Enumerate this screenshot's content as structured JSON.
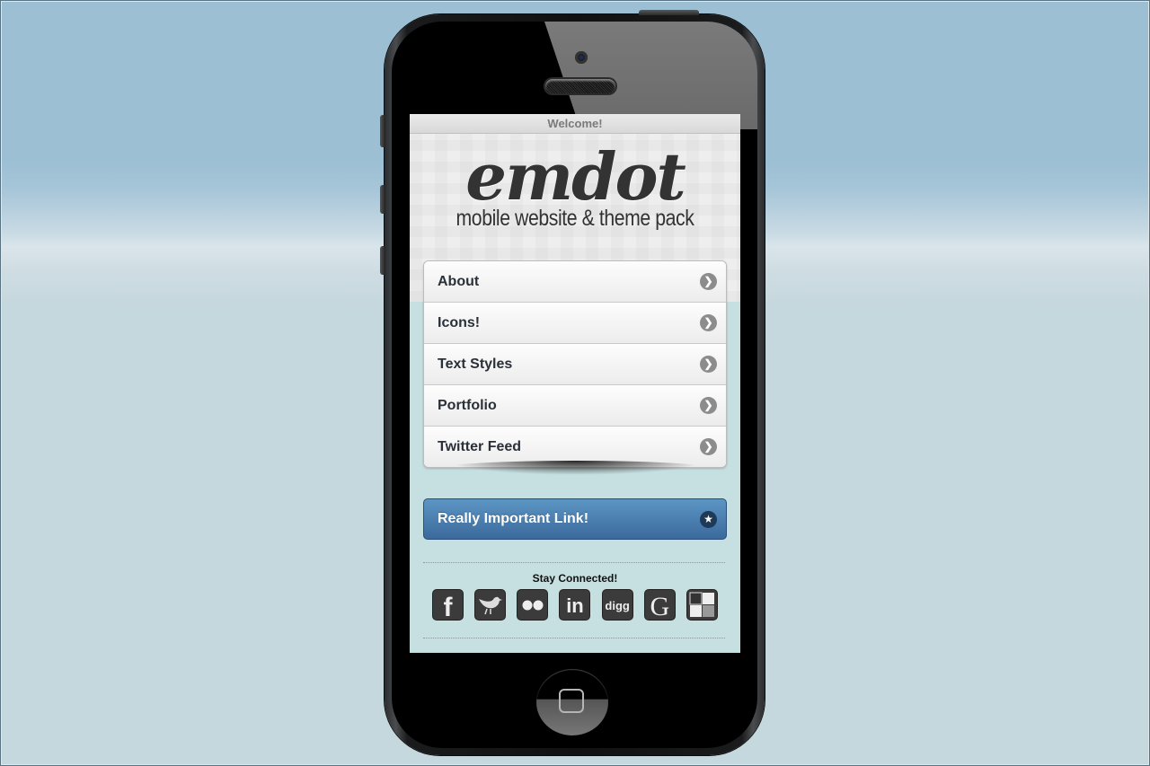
{
  "screen": {
    "header_title": "Welcome!",
    "logo": {
      "title": "emdot",
      "subtitle": "mobile website & theme pack"
    },
    "menu": [
      {
        "label": "About",
        "icon": "chevron-right-icon"
      },
      {
        "label": "Icons!",
        "icon": "chevron-right-icon"
      },
      {
        "label": "Text Styles",
        "icon": "chevron-right-icon"
      },
      {
        "label": "Portfolio",
        "icon": "chevron-right-icon"
      },
      {
        "label": "Twitter Feed",
        "icon": "chevron-right-icon"
      }
    ],
    "important_link": {
      "label": "Really Important Link!",
      "icon": "star-icon"
    },
    "social": {
      "heading": "Stay Connected!",
      "icons": [
        {
          "name": "facebook-icon",
          "glyph": "f"
        },
        {
          "name": "twitter-icon",
          "glyph": "🐦"
        },
        {
          "name": "flickr-icon",
          "glyph": "●●"
        },
        {
          "name": "linkedin-icon",
          "glyph": "in"
        },
        {
          "name": "digg-icon",
          "glyph": "digg"
        },
        {
          "name": "google-icon",
          "glyph": "G"
        },
        {
          "name": "delicious-icon",
          "glyph": ""
        }
      ]
    }
  },
  "colors": {
    "accent_blue": "#3b6a9c",
    "content_bg": "#c6dfe0",
    "menu_text": "#2a3038"
  }
}
